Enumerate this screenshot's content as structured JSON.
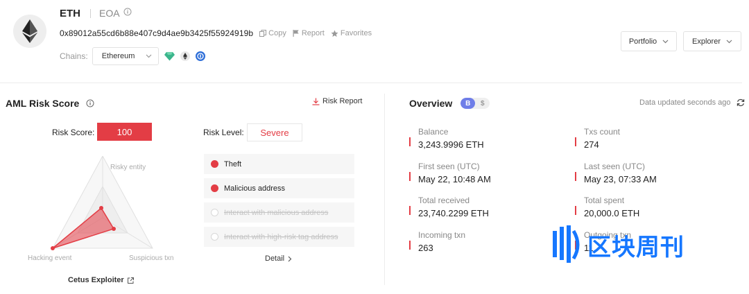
{
  "header": {
    "title": "ETH",
    "account_type": "EOA",
    "address": "0x89012a55cd6b88e407c9d4ae9b3425f55924919b",
    "actions": {
      "copy": "Copy",
      "report": "Report",
      "favorites": "Favorites"
    },
    "chains_label": "Chains:",
    "chain_selected": "Ethereum",
    "buttons": {
      "portfolio": "Portfolio",
      "explorer": "Explorer"
    }
  },
  "aml": {
    "title": "AML Risk Score",
    "risk_report": "Risk Report",
    "risk_score_label": "Risk Score:",
    "risk_score": "100",
    "risk_level_label": "Risk Level:",
    "risk_level": "Severe",
    "radar": {
      "axes": [
        "Risky entity",
        "Hacking event",
        "Suspicious txn"
      ]
    },
    "entity_link": "Cetus Exploiter",
    "risk_items": [
      {
        "label": "Theft",
        "active": true
      },
      {
        "label": "Malicious address",
        "active": true
      },
      {
        "label": "Interact with malicious address",
        "active": false
      },
      {
        "label": "Interact with high-risk tag address",
        "active": false
      }
    ],
    "detail": "Detail"
  },
  "overview": {
    "title": "Overview",
    "currency_btc": "B",
    "currency_usd": "$",
    "updated": "Data updated seconds ago",
    "balance": {
      "label": "Balance",
      "value": "3,243.9996 ETH"
    },
    "txs_count": {
      "label": "Txs count",
      "value": "274"
    },
    "first_seen": {
      "label": "First seen (UTC)",
      "value": "May 22, 10:48 AM"
    },
    "last_seen": {
      "label": "Last seen (UTC)",
      "value": "May 23, 07:33 AM"
    },
    "total_received": {
      "label": "Total received",
      "value": "23,740.2299 ETH"
    },
    "total_spent": {
      "label": "Total spent",
      "value": "20,000.0 ETH"
    },
    "incoming_txn": {
      "label": "Incoming txn",
      "value": "263"
    },
    "outgoing_txn": {
      "label": "Outgoing txn",
      "value": "11"
    }
  },
  "watermark": {
    "text": "区块周刊"
  },
  "colors": {
    "risk_red": "#e33d45",
    "accent_blue": "#6f7ee8",
    "watermark_blue": "#1677ff"
  }
}
